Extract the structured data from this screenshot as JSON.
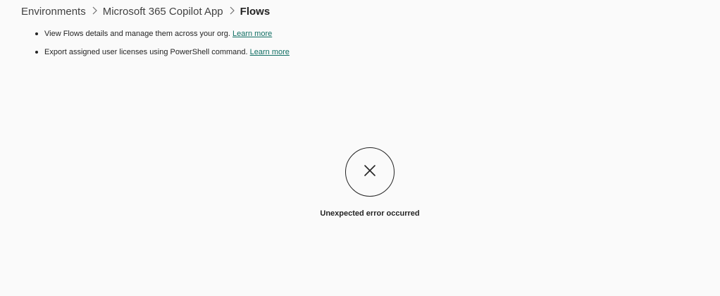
{
  "breadcrumb": {
    "items": [
      "Environments",
      "Microsoft 365 Copilot App"
    ],
    "current": "Flows",
    "separator": ">"
  },
  "info": {
    "items": [
      {
        "text": "View Flows details and manage them across your org.",
        "link": "Learn more"
      },
      {
        "text": "Export assigned user licenses using PowerShell command.",
        "link": "Learn more"
      }
    ]
  },
  "error": {
    "icon": "close-icon",
    "message": "Unexpected error occurred"
  },
  "colors": {
    "link": "#0f6e63",
    "text": "#242424",
    "background": "#fafafa"
  }
}
